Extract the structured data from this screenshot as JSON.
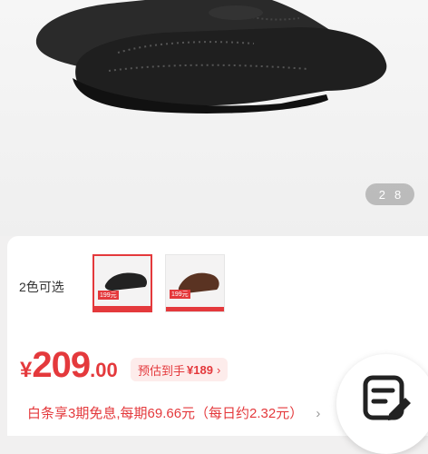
{
  "gallery": {
    "current": "2",
    "total": "8"
  },
  "colors": {
    "label": "2色可选",
    "options": [
      {
        "name": "black",
        "price_badge": "199元"
      },
      {
        "name": "brown",
        "price_badge": "199元"
      }
    ]
  },
  "price": {
    "symbol": "¥",
    "integer": "209",
    "decimal": ".00",
    "estimate_prefix": "预估到手",
    "estimate_value": "¥189",
    "estimate_chevron": "›"
  },
  "installment": {
    "text": "白条享3期免息,每期69.66元（每日约2.32元）",
    "chevron": "›"
  },
  "accent_color": "#e4393c"
}
